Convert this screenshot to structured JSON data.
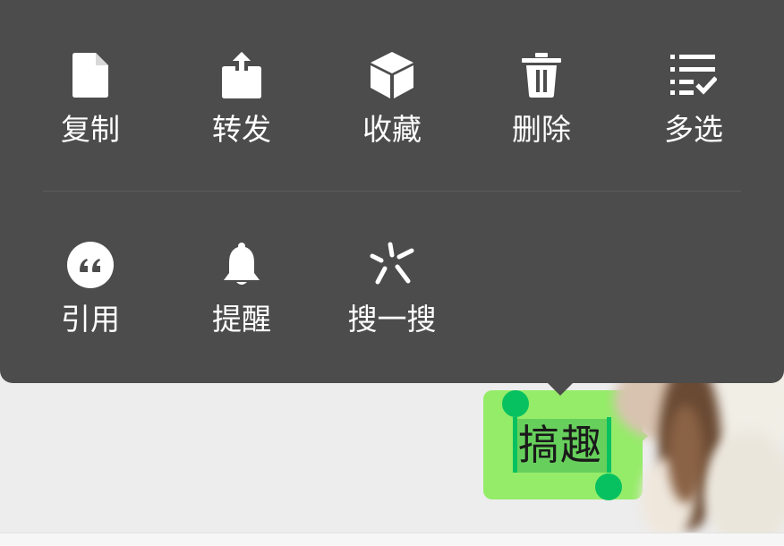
{
  "menu": {
    "row1": [
      {
        "label": "复制",
        "icon": "document-icon"
      },
      {
        "label": "转发",
        "icon": "share-icon"
      },
      {
        "label": "收藏",
        "icon": "cube-icon"
      },
      {
        "label": "删除",
        "icon": "trash-icon"
      },
      {
        "label": "多选",
        "icon": "multi-select-icon"
      }
    ],
    "row2": [
      {
        "label": "引用",
        "icon": "quote-icon"
      },
      {
        "label": "提醒",
        "icon": "bell-icon"
      },
      {
        "label": "搜一搜",
        "icon": "search-sparkle-icon"
      }
    ]
  },
  "message": {
    "text": "搞趣"
  },
  "colors": {
    "menu_background": "#4c4c4c",
    "bubble": "#95ec69",
    "selection": "#07c160",
    "chat_background": "#ededed"
  }
}
